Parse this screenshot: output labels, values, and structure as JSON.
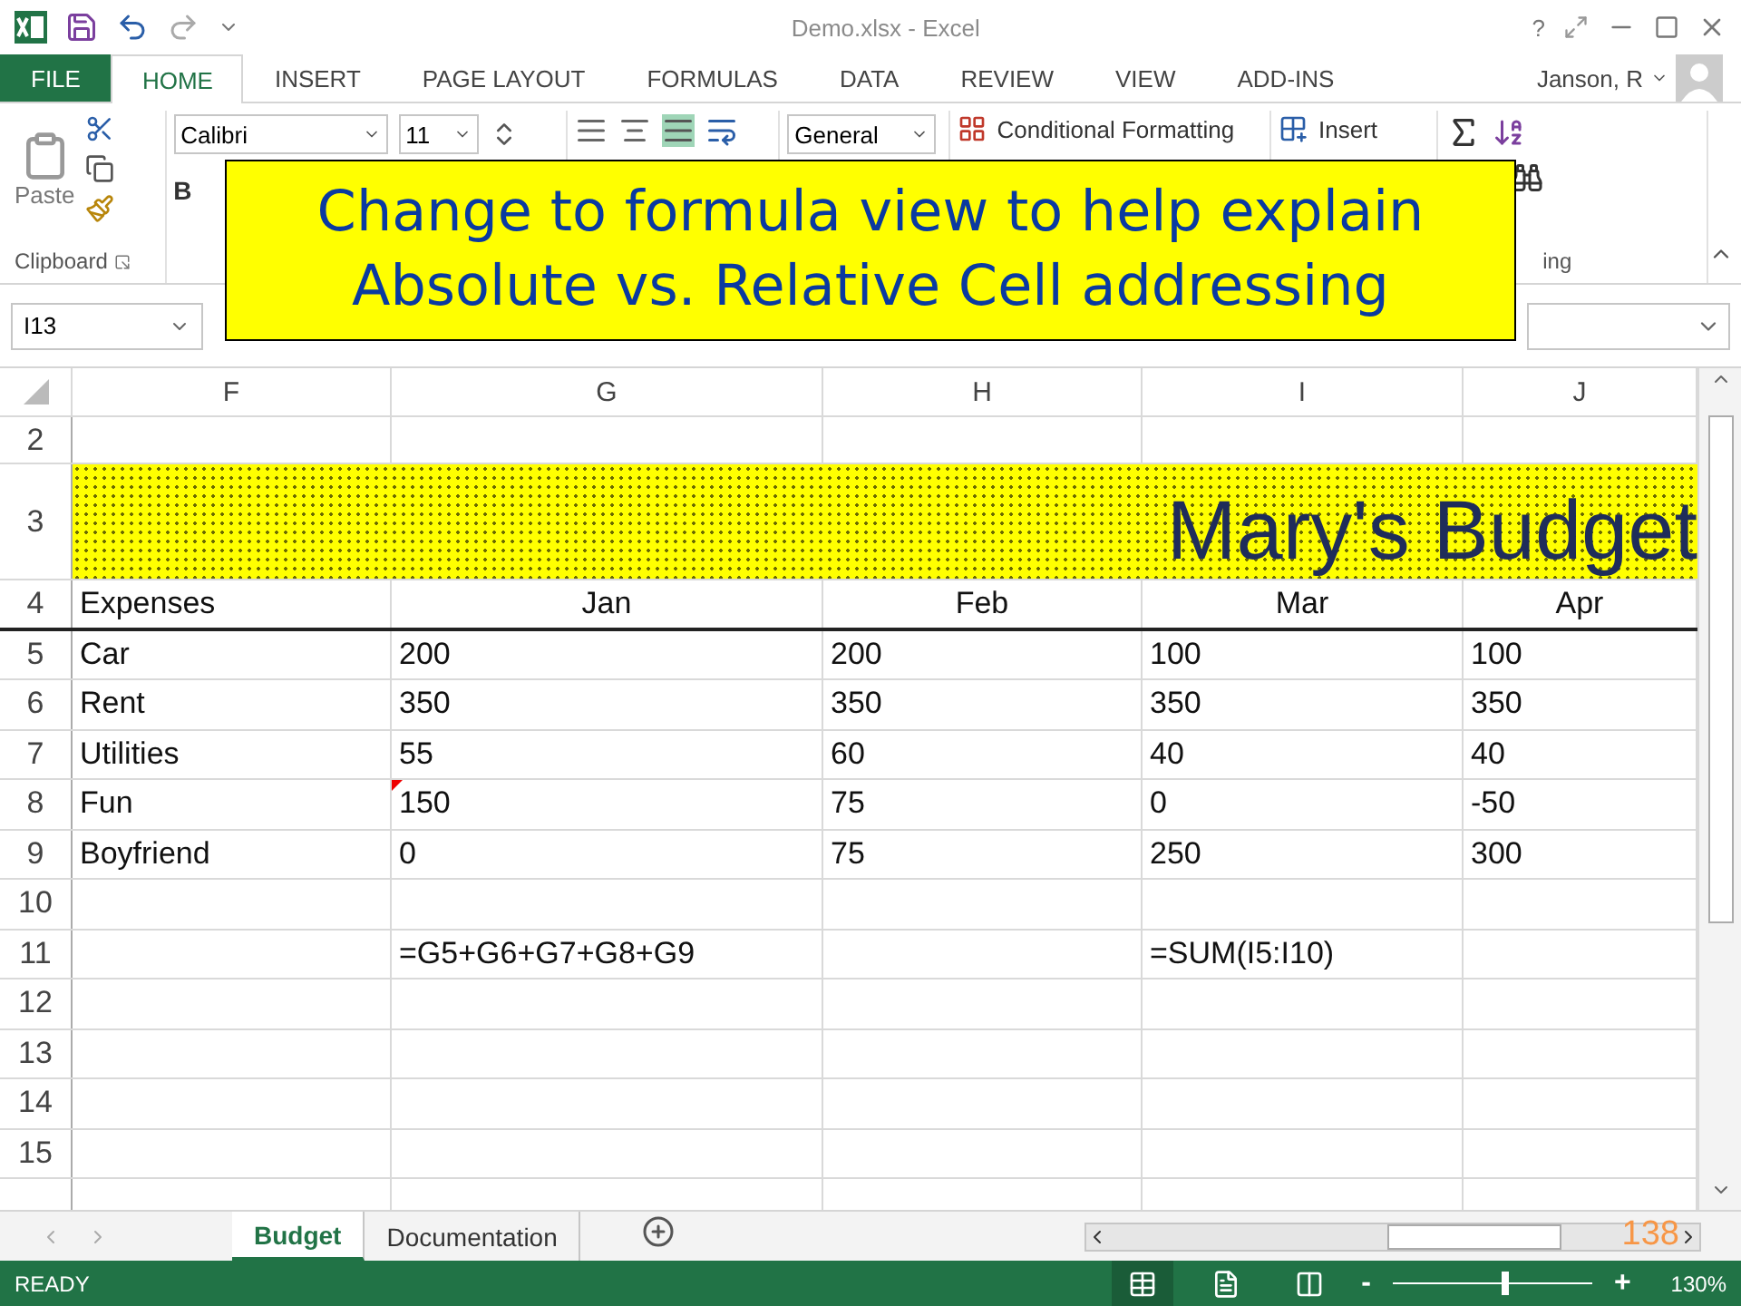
{
  "title_bar": {
    "title": "Demo.xlsx - Excel",
    "help": "?"
  },
  "ribbon_tabs": [
    {
      "label": "FILE",
      "kind": "file",
      "selected": false
    },
    {
      "label": "HOME",
      "kind": "tab",
      "selected": true
    },
    {
      "label": "INSERT",
      "kind": "tab",
      "selected": false
    },
    {
      "label": "PAGE LAYOUT",
      "kind": "tab",
      "selected": false
    },
    {
      "label": "FORMULAS",
      "kind": "tab",
      "selected": false
    },
    {
      "label": "DATA",
      "kind": "tab",
      "selected": false
    },
    {
      "label": "REVIEW",
      "kind": "tab",
      "selected": false
    },
    {
      "label": "VIEW",
      "kind": "tab",
      "selected": false
    },
    {
      "label": "ADD-INS",
      "kind": "tab",
      "selected": false
    }
  ],
  "user": "Janson, R",
  "ribbon": {
    "paste": "Paste",
    "clipboard_label": "Clipboard",
    "font": "Calibri",
    "font_size": "11",
    "bold": "B",
    "number_format": "General",
    "conditional_formatting": "Conditional Formatting",
    "insert": "Insert",
    "editing_label_fragment": "ing"
  },
  "name_box": "I13",
  "columns": [
    "F",
    "G",
    "H",
    "I",
    "J"
  ],
  "rows": [
    {
      "header": "2",
      "kind": "plain",
      "cells": []
    },
    {
      "header": "3",
      "kind": "title",
      "text": "Mary's Budget"
    },
    {
      "header": "4",
      "kind": "heading",
      "cells": [
        {
          "text": "Expenses"
        },
        {
          "text": "Jan"
        },
        {
          "text": "Feb"
        },
        {
          "text": "Mar"
        },
        {
          "text": "Apr"
        }
      ]
    },
    {
      "header": "5",
      "kind": "plain",
      "cells": [
        {
          "text": "Car"
        },
        {
          "text": "200"
        },
        {
          "text": "200"
        },
        {
          "text": "100"
        },
        {
          "text": "100"
        }
      ]
    },
    {
      "header": "6",
      "kind": "plain",
      "cells": [
        {
          "text": "Rent"
        },
        {
          "text": "350"
        },
        {
          "text": "350"
        },
        {
          "text": "350"
        },
        {
          "text": "350"
        }
      ]
    },
    {
      "header": "7",
      "kind": "plain",
      "cells": [
        {
          "text": "Utilities"
        },
        {
          "text": "55"
        },
        {
          "text": "60"
        },
        {
          "text": "40"
        },
        {
          "text": "40"
        }
      ]
    },
    {
      "header": "8",
      "kind": "plain",
      "cells": [
        {
          "text": "Fun"
        },
        {
          "text": "150",
          "comment": true
        },
        {
          "text": "75"
        },
        {
          "text": "0"
        },
        {
          "text": "-50"
        }
      ]
    },
    {
      "header": "9",
      "kind": "plain",
      "cells": [
        {
          "text": "Boyfriend"
        },
        {
          "text": "0"
        },
        {
          "text": "75"
        },
        {
          "text": "250"
        },
        {
          "text": "300"
        }
      ]
    },
    {
      "header": "10",
      "kind": "plain",
      "cells": []
    },
    {
      "header": "11",
      "kind": "plain",
      "cells": [
        {},
        {
          "text": "=G5+G6+G7+G8+G9"
        },
        {},
        {
          "text": "=SUM(I5:I10)"
        },
        {}
      ]
    },
    {
      "header": "12",
      "kind": "plain",
      "cells": []
    },
    {
      "header": "13",
      "kind": "plain",
      "cells": []
    },
    {
      "header": "14",
      "kind": "plain",
      "cells": []
    },
    {
      "header": "15",
      "kind": "plain",
      "cells": []
    },
    {
      "kind": "plain",
      "cells": []
    }
  ],
  "sheets": [
    {
      "label": "Budget",
      "selected": true
    },
    {
      "label": "Documentation",
      "selected": false
    }
  ],
  "status": "READY",
  "zoom": {
    "reading": "130%",
    "level": 0.55,
    "minus": "-",
    "plus": "+"
  },
  "callout": [
    "Change to formula view to help explain",
    "Absolute vs. Relative Cell addressing"
  ],
  "slide_number": "138"
}
